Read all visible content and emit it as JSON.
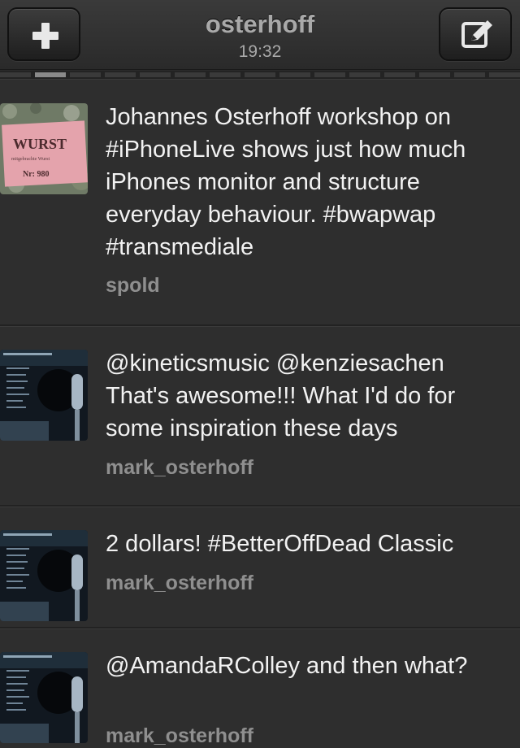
{
  "header": {
    "title": "osterhoff",
    "time": "19:32",
    "left_button_icon": "plus-icon",
    "right_button_icon": "compose-icon"
  },
  "page_indicator": {
    "segment_count": 15,
    "active_index": 1
  },
  "tweets": [
    {
      "text": "Johannes Osterhoff workshop on #iPhoneLive shows just how much iPhones monitor and structure everyday behaviour. #bwapwap #transmediale",
      "user": "spold",
      "avatar": {
        "icon": "wurst-ticket-avatar",
        "label": "WURST",
        "subtext": "mitgebrachte Wurst",
        "number": "Nr: 980"
      }
    },
    {
      "text": "@kineticsmusic @kenziesachen That's awesome!!! What I'd do for some inspiration these days",
      "user": "mark_osterhoff",
      "avatar": {
        "icon": "microphone-avatar"
      }
    },
    {
      "text": "2 dollars! #BetterOffDead Classic",
      "user": "mark_osterhoff",
      "avatar": {
        "icon": "microphone-avatar"
      }
    },
    {
      "text": "@AmandaRColley and then what?",
      "user": "mark_osterhoff",
      "avatar": {
        "icon": "microphone-avatar"
      }
    }
  ]
}
